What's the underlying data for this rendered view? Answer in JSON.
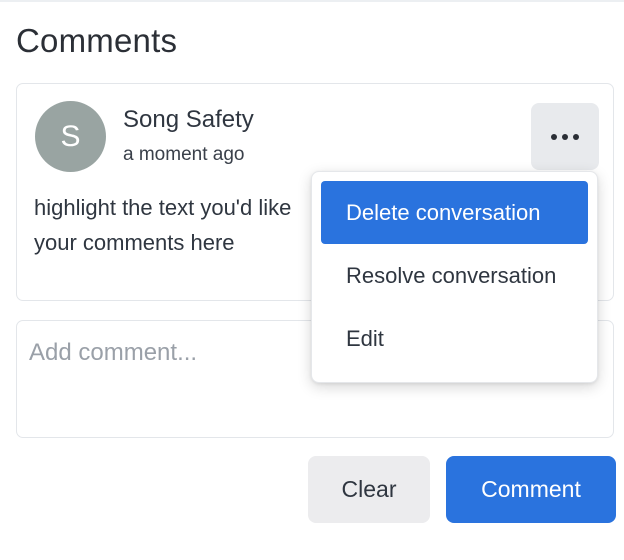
{
  "page": {
    "title": "Comments"
  },
  "comment": {
    "avatar_initial": "S",
    "author": "Song Safety",
    "timestamp": "a moment ago",
    "body_line1": "highlight the text you'd like",
    "body_line2": "your comments here",
    "more_icon": "more-horizontal-icon"
  },
  "menu": {
    "items": [
      {
        "label": "Delete conversation",
        "highlighted": true
      },
      {
        "label": "Resolve conversation",
        "highlighted": false
      },
      {
        "label": "Edit",
        "highlighted": false
      }
    ]
  },
  "composer": {
    "placeholder": "Add comment...",
    "value": ""
  },
  "actions": {
    "clear_label": "Clear",
    "comment_label": "Comment"
  },
  "colors": {
    "accent": "#2a73de",
    "avatar_bg": "#99a4a2",
    "secondary_button_bg": "#ececee"
  }
}
